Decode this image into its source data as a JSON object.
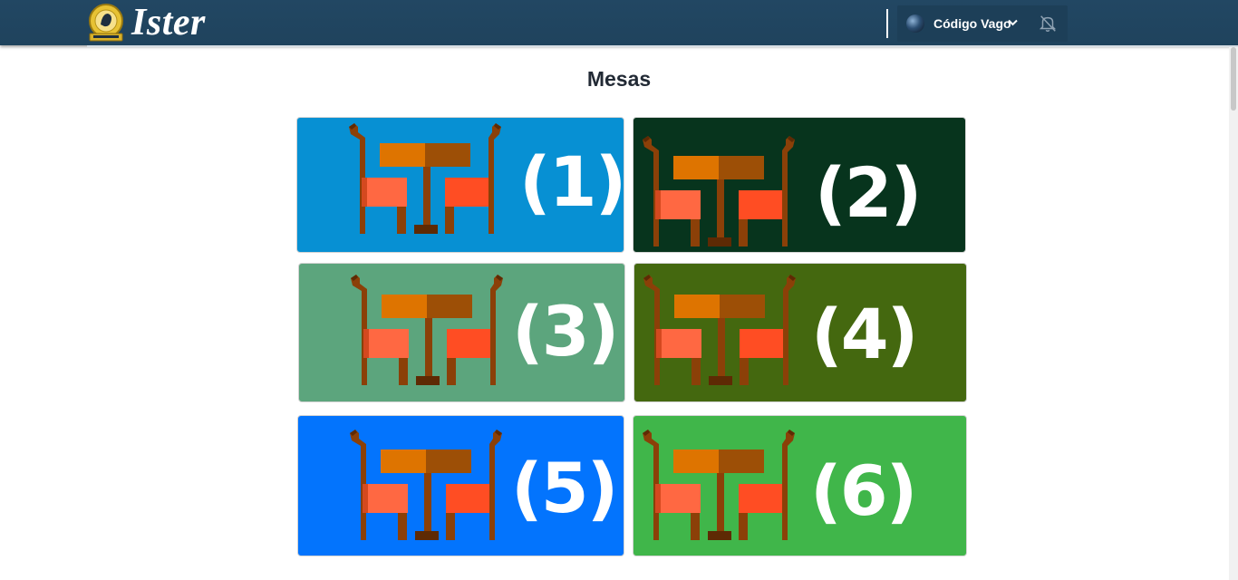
{
  "header": {
    "brand": "Ister",
    "user_name": "Código Vago",
    "icons": {
      "logo": "ister-logo-badge",
      "avatar": "user-avatar",
      "chevron": "chevron-down-icon",
      "notifications": "bell-off-icon"
    }
  },
  "page": {
    "title": "Mesas"
  },
  "tables": [
    {
      "label": "(1)",
      "color": "#0790d3"
    },
    {
      "label": "(2)",
      "color": "#07341d"
    },
    {
      "label": "(3)",
      "color": "#5ca57d"
    },
    {
      "label": "(4)",
      "color": "#44680f"
    },
    {
      "label": "(5)",
      "color": "#0374fd"
    },
    {
      "label": "(6)",
      "color": "#40b64a"
    }
  ],
  "colors": {
    "header_bg": "#224763",
    "chair_wood": "#8b4008",
    "table_top": "#de7400",
    "seat": "#ff6842"
  }
}
